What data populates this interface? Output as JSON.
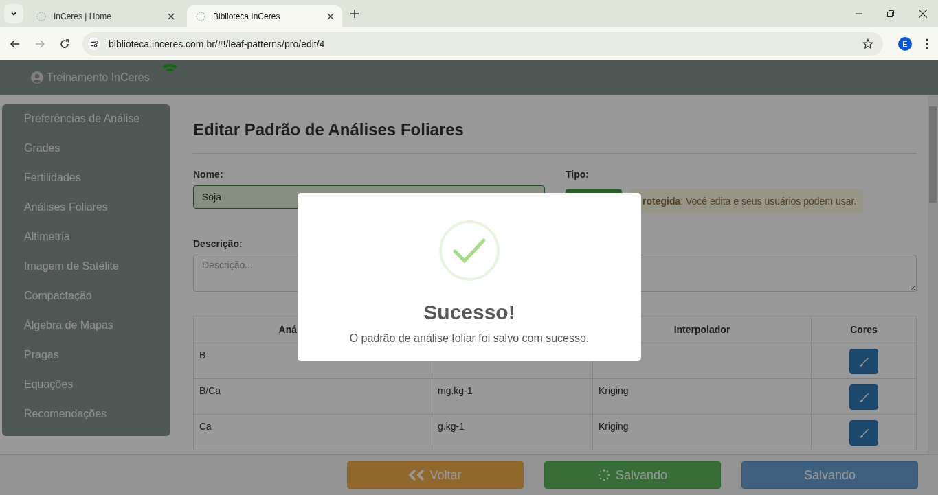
{
  "browser": {
    "tabs": [
      {
        "title": "InCeres | Home",
        "selected": false
      },
      {
        "title": "Biblioteca InCeres",
        "selected": true
      }
    ],
    "url": "biblioteca.inceres.com.br/#!/leaf-patterns/pro/edit/4",
    "profile": "E"
  },
  "header": {
    "user": "Treinamento InCeres"
  },
  "sidebar": {
    "items": [
      {
        "label": "Preferências de Análise"
      },
      {
        "label": "Grades"
      },
      {
        "label": "Fertilidades"
      },
      {
        "label": "Análises Foliares"
      },
      {
        "label": "Altimetria"
      },
      {
        "label": "Imagem de Satélite"
      },
      {
        "label": "Compactação"
      },
      {
        "label": "Álgebra de Mapas"
      },
      {
        "label": "Pragas"
      },
      {
        "label": "Equações"
      },
      {
        "label": "Recomendações"
      }
    ]
  },
  "page": {
    "title": "Editar Padrão de Análises Foliares",
    "name_label": "Nome:",
    "name_value": "Soja",
    "type_label": "Tipo:",
    "type_note": "**rotegida**: Você edita e seus usuários podem usar.",
    "description_label": "Descrição:",
    "description_placeholder": "Descrição...",
    "table": {
      "columns": [
        "Aná",
        "",
        "Interpolador",
        "Cores"
      ],
      "rows": [
        [
          "B",
          "",
          ""
        ],
        [
          "B/Ca",
          "mg.kg-1",
          "Kriging"
        ],
        [
          "Ca",
          "g.kg-1",
          "Kriging"
        ]
      ]
    }
  },
  "footer": {
    "buttons": [
      {
        "kind": "back",
        "label": "Voltar"
      },
      {
        "kind": "spinner",
        "label": "Salvando"
      },
      {
        "kind": "plain",
        "label": "Salvando"
      }
    ]
  },
  "dialog": {
    "title": "Sucesso!",
    "message": "O padrão de análise foliar foi salvo com sucesso."
  }
}
